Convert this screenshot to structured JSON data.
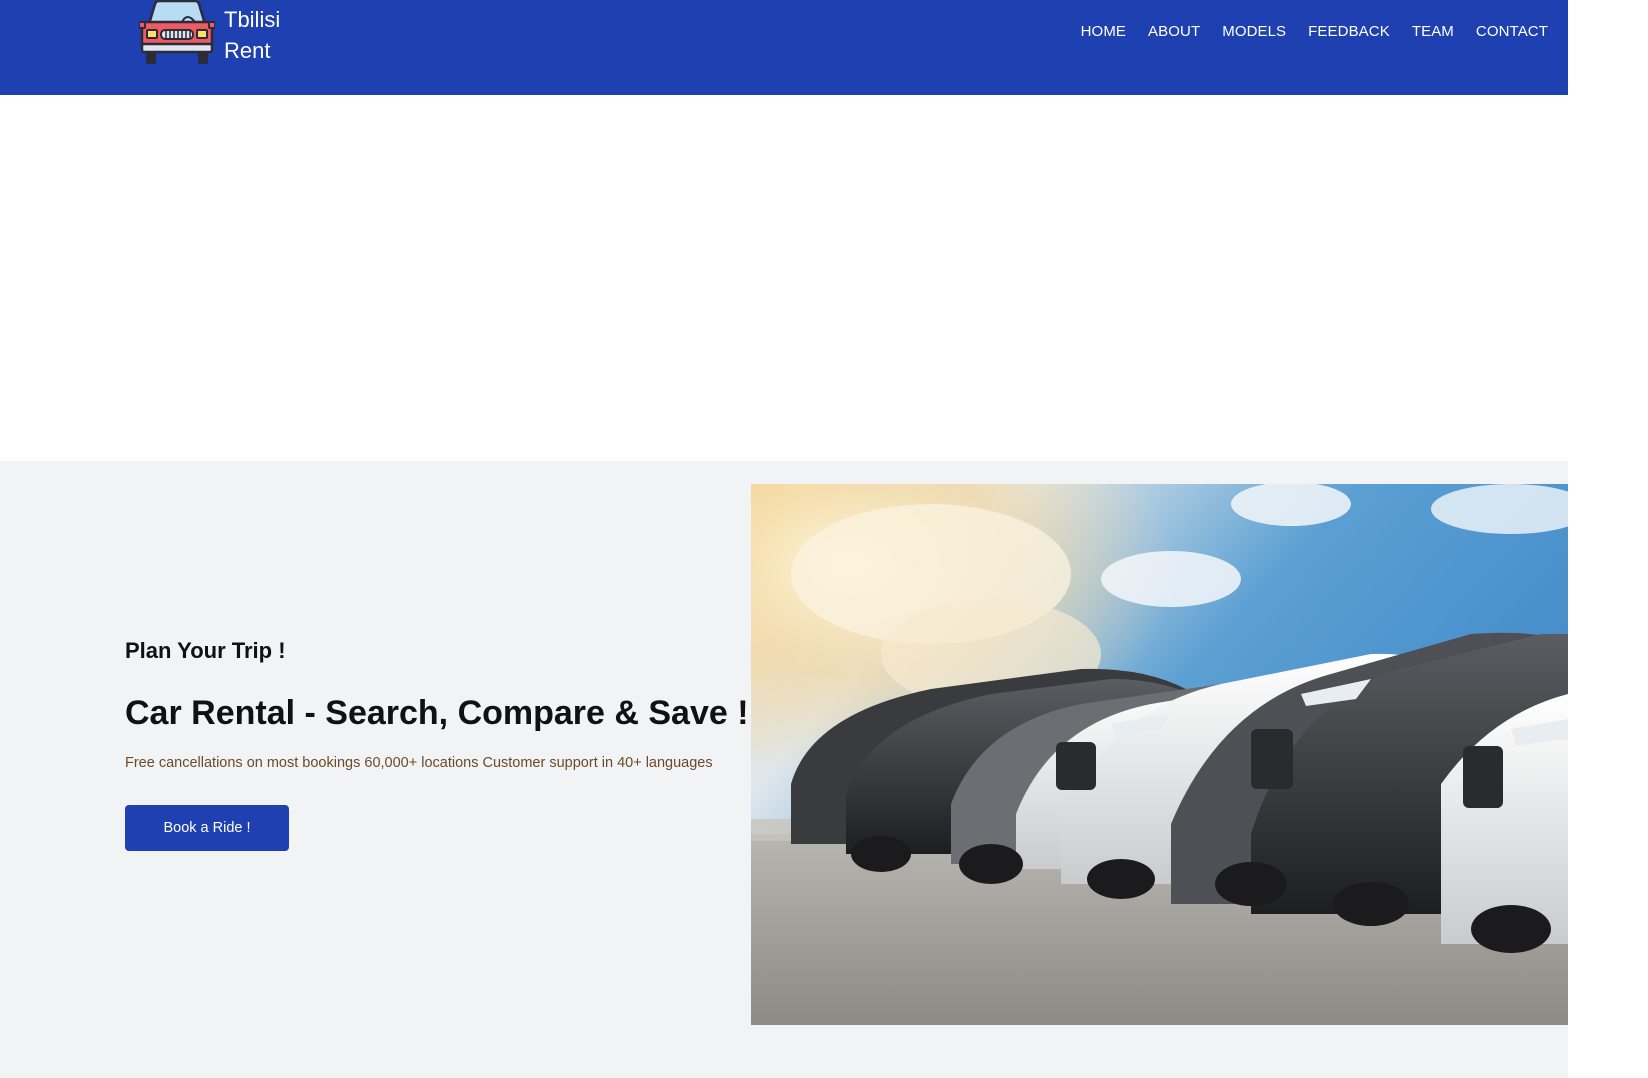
{
  "header": {
    "brand": "Tbilisi Rent",
    "nav": [
      "HOME",
      "ABOUT",
      "MODELS",
      "FEEDBACK",
      "TEAM",
      "CONTACT"
    ]
  },
  "hero": {
    "eyebrow": "Plan Your Trip !",
    "headline": "Car Rental - Search, Compare & Save !",
    "subtext": "Free cancellations on most bookings 60,000+ locations Customer support in 40+ languages",
    "cta_label": "Book a Ride !"
  },
  "colors": {
    "header_bg": "#1f40b0",
    "hero_bg": "#f2f3f5",
    "button_bg": "#1f40b0",
    "subtext": "#6b4a2a"
  },
  "icons": {
    "logo": "car-front-icon"
  }
}
